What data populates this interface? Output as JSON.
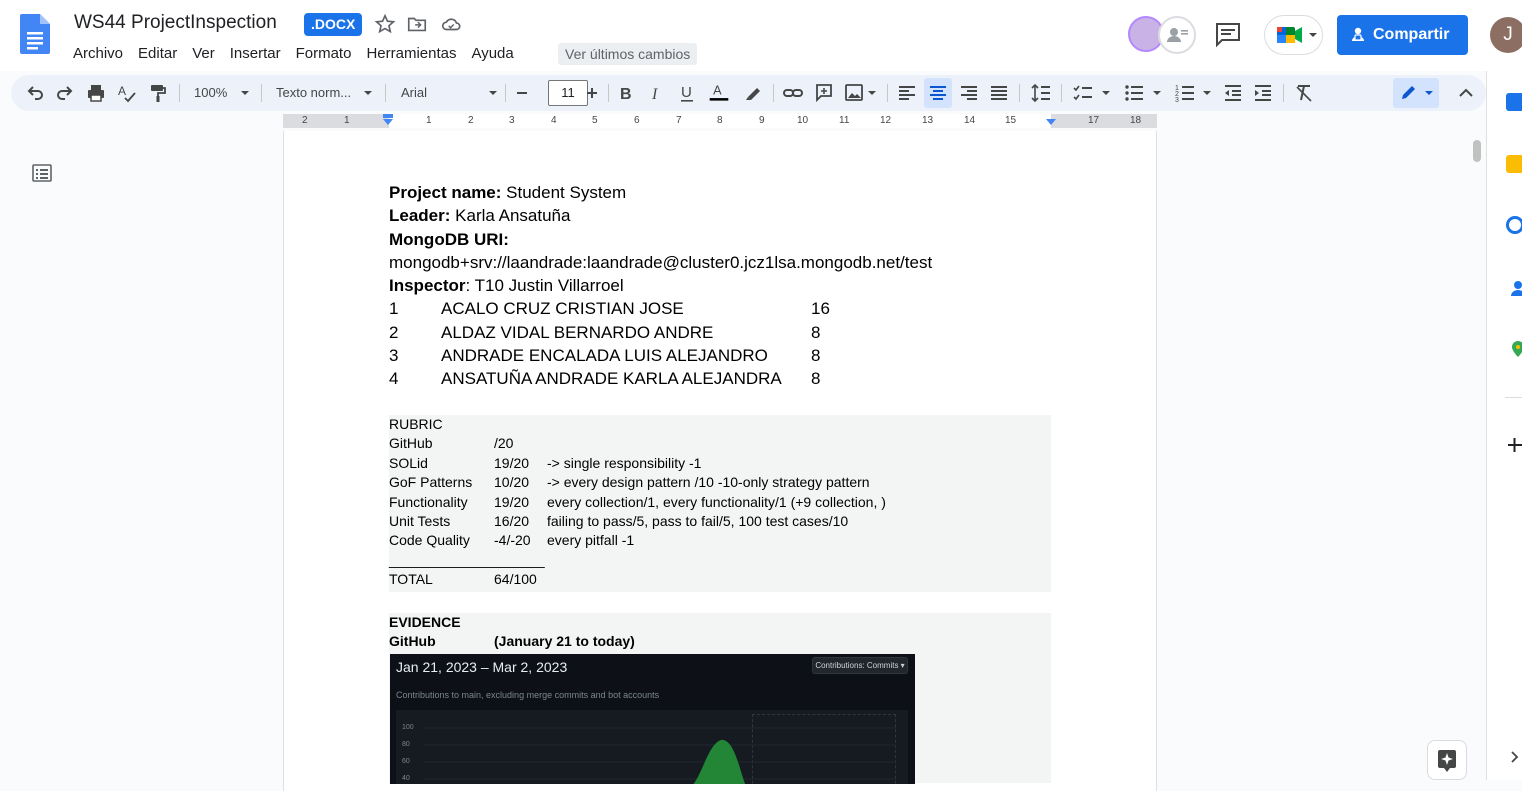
{
  "document": {
    "title": "WS44 ProjectInspection",
    "format_badge": ".DOCX"
  },
  "menu": {
    "items": [
      "Archivo",
      "Editar",
      "Ver",
      "Insertar",
      "Formato",
      "Herramientas",
      "Ayuda"
    ],
    "last_edit": "Ver últimos cambios"
  },
  "header": {
    "share_label": "Compartir",
    "account_initial": "J"
  },
  "toolbar": {
    "zoom": "100%",
    "style": "Texto norm...",
    "font": "Arial",
    "font_size": "11"
  },
  "ruler": {
    "labels": [
      "2",
      "1",
      "1",
      "2",
      "3",
      "4",
      "5",
      "6",
      "7",
      "8",
      "9",
      "10",
      "11",
      "12",
      "13",
      "14",
      "15",
      "17",
      "18"
    ]
  },
  "content": {
    "project_label": "Project name:",
    "project_value": " Student System",
    "leader_label": "Leader:",
    "leader_value": " Karla Ansatuña",
    "mongo_label": "MongoDB URI:",
    "mongo_value": "mongodb+srv://laandrade:laandrade@cluster0.jcz1lsa.mongodb.net/test",
    "inspector_label": "Inspector",
    "inspector_value": ": T10 Justin Villarroel",
    "roster": [
      {
        "num": "1",
        "name": "ACALO CRUZ CRISTIAN JOSE",
        "score": "16"
      },
      {
        "num": "2",
        "name": "ALDAZ VIDAL BERNARDO ANDRE",
        "score": "8"
      },
      {
        "num": "3",
        "name": "ANDRADE ENCALADA LUIS ALEJANDRO",
        "score": "8"
      },
      {
        "num": "4",
        "name": "ANSATUÑA ANDRADE KARLA ALEJANDRA",
        "score": "8"
      }
    ]
  },
  "rubric": {
    "heading": "RUBRIC",
    "rows": [
      {
        "label": "GitHub",
        "score": "/20",
        "note": ""
      },
      {
        "label": "SOLid",
        "score": "19/20",
        "note": "-> single responsibility -1"
      },
      {
        "label": "GoF Patterns",
        "score": "10/20",
        "note": "-> every design pattern /10  -10-only strategy pattern"
      },
      {
        "label": "Functionality",
        "score": "19/20",
        "note": "every collection/1, every functionality/1  (+9 collection, )"
      },
      {
        "label": "Unit Tests",
        "score": "16/20",
        "note": "failing to pass/5, pass to fail/5, 100 test cases/10"
      },
      {
        "label": "Code Quality",
        "score": "-4/-20",
        "note": "every pitfall -1"
      }
    ],
    "divider": "____________________",
    "total_label": "TOTAL",
    "total_value": "64/100"
  },
  "evidence": {
    "heading": "EVIDENCE",
    "github_label": "GitHub",
    "github_range": "(January 21 to today)",
    "screenshot": {
      "date_range": "Jan 21, 2023 – Mar 2, 2023",
      "dropdown": "Contributions: Commits ▾",
      "subtitle": "Contributions to main, excluding merge commits and bot accounts",
      "ticks": [
        "100",
        "80",
        "60",
        "40"
      ]
    }
  },
  "colors": {
    "brand_blue": "#1a73e8",
    "toolbar_bg": "#edf2fa",
    "page_bg": "#f9fbfd",
    "rubric_bg": "#f3f5f4",
    "github_dark": "#0d1117",
    "github_green": "#238636"
  },
  "icons": {
    "docs_logo": "docs-logo-icon",
    "star": "star-icon",
    "move": "folder-move-icon",
    "cloud": "cloud-status-icon",
    "comments": "comments-icon",
    "meet": "meet-icon",
    "share": "share-person-icon",
    "outline": "outline-icon"
  }
}
